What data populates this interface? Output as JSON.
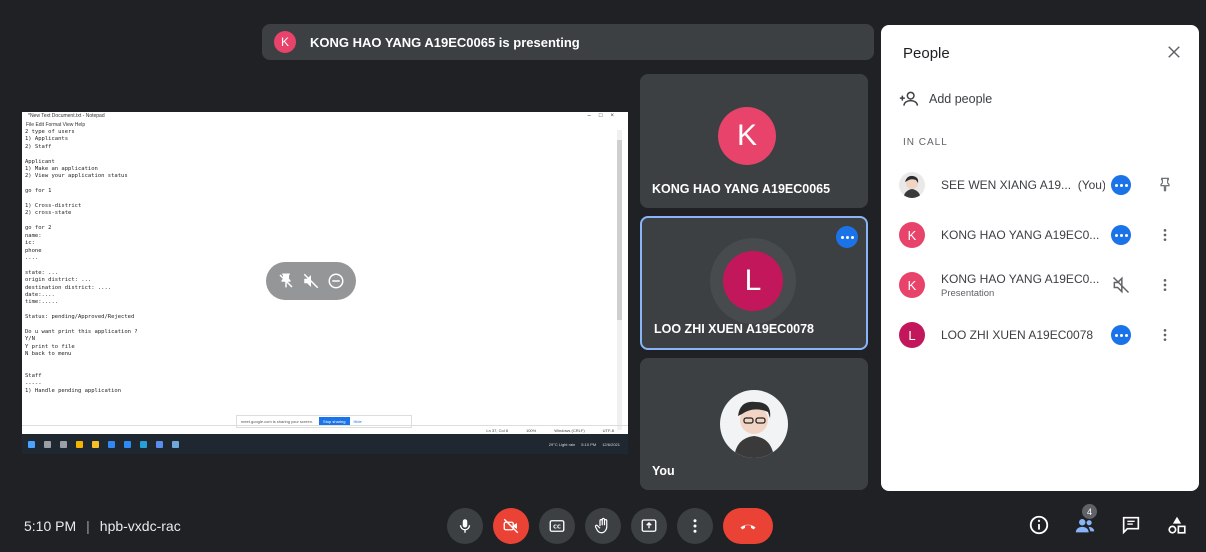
{
  "banner": {
    "avatar_letter": "K",
    "text": "KONG HAO YANG A19EC0065 is presenting"
  },
  "screen": {
    "notepad_title": "*New Text Document.txt - Notepad",
    "notepad_menu": "File  Edit  Format  View  Help",
    "notepad_lines": "2 type of users\n1) Applicants\n2) Staff\n\nApplicant\n1) Make an application\n2) View your application status\n\ngo for 1\n\n1) Cross-district\n2) cross-state\n\ngo for 2\nname:\nic:\nphone\n....\n\nstate: ...\norigin district: ...\ndestination district: ....\ndate:....\ntime:.....\n\nStatus: pending/Approved/Rejected\n\nDo u want print this application ?\nY/N\nY print to file\nN back to menu\n\n\nStaff\n-----\n1) Handle pending application",
    "share_text": "meet.google.com is sharing your screen.",
    "stop_label": "Stop sharing",
    "hide_label": "Hide",
    "status": [
      "Ln 37, Col 8",
      "100%",
      "Windows (CRLF)",
      "UTF-8"
    ],
    "tray_weather": "29°C  Light rain",
    "tray_time": "5:10 PM",
    "tray_date": "12/6/2021"
  },
  "tiles": {
    "k": {
      "letter": "K",
      "name": "KONG HAO YANG A19EC0065",
      "color": "#e8436b"
    },
    "l": {
      "letter": "L",
      "name": "LOO ZHI XUEN A19EC0078",
      "color": "#c2185b"
    },
    "you": {
      "name": "You"
    }
  },
  "panel": {
    "title": "People",
    "add_people": "Add people",
    "in_call": "IN CALL",
    "people": [
      {
        "name": "SEE WEN XIANG A19...",
        "suffix": "(You)",
        "sub": ""
      },
      {
        "letter": "K",
        "name": "KONG HAO YANG A19EC0...",
        "sub": ""
      },
      {
        "letter": "K",
        "name": "KONG HAO YANG A19EC0...",
        "sub": "Presentation"
      },
      {
        "letter": "L",
        "name": "LOO ZHI XUEN A19EC0078",
        "sub": ""
      }
    ]
  },
  "bottom": {
    "time": "5:10 PM",
    "separator": "|",
    "meeting_code": "hpb-vxdc-rac",
    "people_count": "4"
  }
}
